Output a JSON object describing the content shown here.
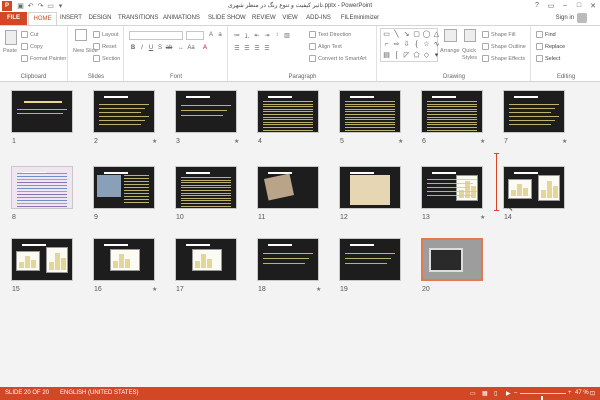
{
  "window": {
    "title": "تاثیر کیفیت و تنوع رنگ در منظر شهری.pptx - PowerPoint",
    "qat": [
      "save-icon",
      "undo-icon",
      "redo-icon",
      "start-from-beginning-icon",
      "customize-qat-icon"
    ],
    "controls": [
      "help-icon",
      "ribbon-display-icon",
      "minimize-icon",
      "maximize-icon",
      "close-icon"
    ]
  },
  "tabs": [
    "FILE",
    "HOME",
    "INSERT",
    "DESIGN",
    "TRANSITIONS",
    "ANIMATIONS",
    "SLIDE SHOW",
    "REVIEW",
    "VIEW",
    "ADD-INS",
    "FILEminimizer"
  ],
  "active_tab": "HOME",
  "signin": "Sign in",
  "ribbon": {
    "clipboard": {
      "label": "Clipboard",
      "paste": "Paste",
      "cut": "Cut",
      "copy": "Copy",
      "format_painter": "Format Painter"
    },
    "slides": {
      "label": "Slides",
      "new_slide": "New Slide",
      "layout": "Layout",
      "reset": "Reset",
      "section": "Section"
    },
    "font": {
      "label": "Font",
      "family_value": "",
      "size_value": ""
    },
    "paragraph": {
      "label": "Paragraph",
      "text_direction": "Text Direction",
      "align_text": "Align Text",
      "convert_smartart": "Convert to SmartArt"
    },
    "drawing": {
      "label": "Drawing",
      "arrange": "Arrange",
      "quick_styles": "Quick Styles",
      "shape_fill": "Shape Fill",
      "shape_outline": "Shape Outline",
      "shape_effects": "Shape Effects"
    },
    "editing": {
      "label": "Editing",
      "find": "Find",
      "replace": "Replace",
      "select": "Select"
    }
  },
  "slides": [
    {
      "num": "1",
      "star": false,
      "kind": "title"
    },
    {
      "num": "2",
      "star": true,
      "kind": "bullets"
    },
    {
      "num": "3",
      "star": true,
      "kind": "sparse"
    },
    {
      "num": "4",
      "star": false,
      "kind": "dense"
    },
    {
      "num": "5",
      "star": true,
      "kind": "dense"
    },
    {
      "num": "6",
      "star": true,
      "kind": "dense"
    },
    {
      "num": "7",
      "star": true,
      "kind": "bullets"
    },
    {
      "num": "8",
      "star": false,
      "kind": "colorful"
    },
    {
      "num": "9",
      "star": false,
      "kind": "imageleft"
    },
    {
      "num": "10",
      "star": false,
      "kind": "dense"
    },
    {
      "num": "11",
      "star": false,
      "kind": "imagecenter"
    },
    {
      "num": "12",
      "star": false,
      "kind": "map"
    },
    {
      "num": "13",
      "star": true,
      "kind": "chartright"
    },
    {
      "num": "14",
      "star": false,
      "kind": "twocharts"
    },
    {
      "num": "15",
      "star": false,
      "kind": "twocharts"
    },
    {
      "num": "16",
      "star": true,
      "kind": "smallchart"
    },
    {
      "num": "17",
      "star": false,
      "kind": "smallchart"
    },
    {
      "num": "18",
      "star": true,
      "kind": "sparse"
    },
    {
      "num": "19",
      "star": false,
      "kind": "sparse"
    },
    {
      "num": "20",
      "star": false,
      "kind": "photo"
    }
  ],
  "status": {
    "slide_info": "SLIDE 20 OF 20",
    "language": "ENGLISH (UNITED STATES)",
    "zoom": "47 %",
    "zoom_level": 0.47
  }
}
